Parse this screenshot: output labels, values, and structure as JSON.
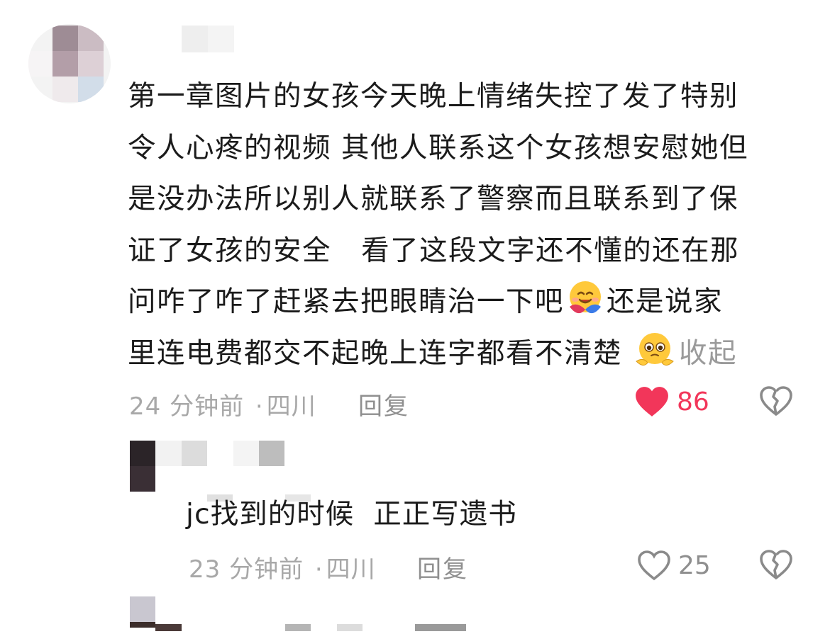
{
  "comment1": {
    "text_lines": [
      "第一章图片的女孩今天晚上情绪失控了发了特别",
      "令人心疼的视频 其他人联系这个女孩想安慰她但",
      "是没办法所以别人就联系了警察而且联系到了保",
      "证了女孩的安全   看了这段文字还不懂的还在那",
      "问咋了咋了赶紧去把眼睛治一下吧",
      "还是说家",
      "里连电费都交不起晚上连字都看不清楚"
    ],
    "collapse_label": "收起",
    "emoji_1": "hugging-face-emoji",
    "emoji_2": "pleading-face-emoji",
    "time": "24 分钟前",
    "location": "四川",
    "reply_label": "回复",
    "like_count": "86",
    "liked": true
  },
  "comment2": {
    "text": "jc找到的时候  正正写遗书",
    "time": "23 分钟前",
    "location": "四川",
    "reply_label": "回复",
    "like_count": "25",
    "liked": false
  },
  "meta_separator": "·",
  "colors": {
    "like_active": "#f2365a",
    "meta_grey": "#a8a8a8"
  }
}
